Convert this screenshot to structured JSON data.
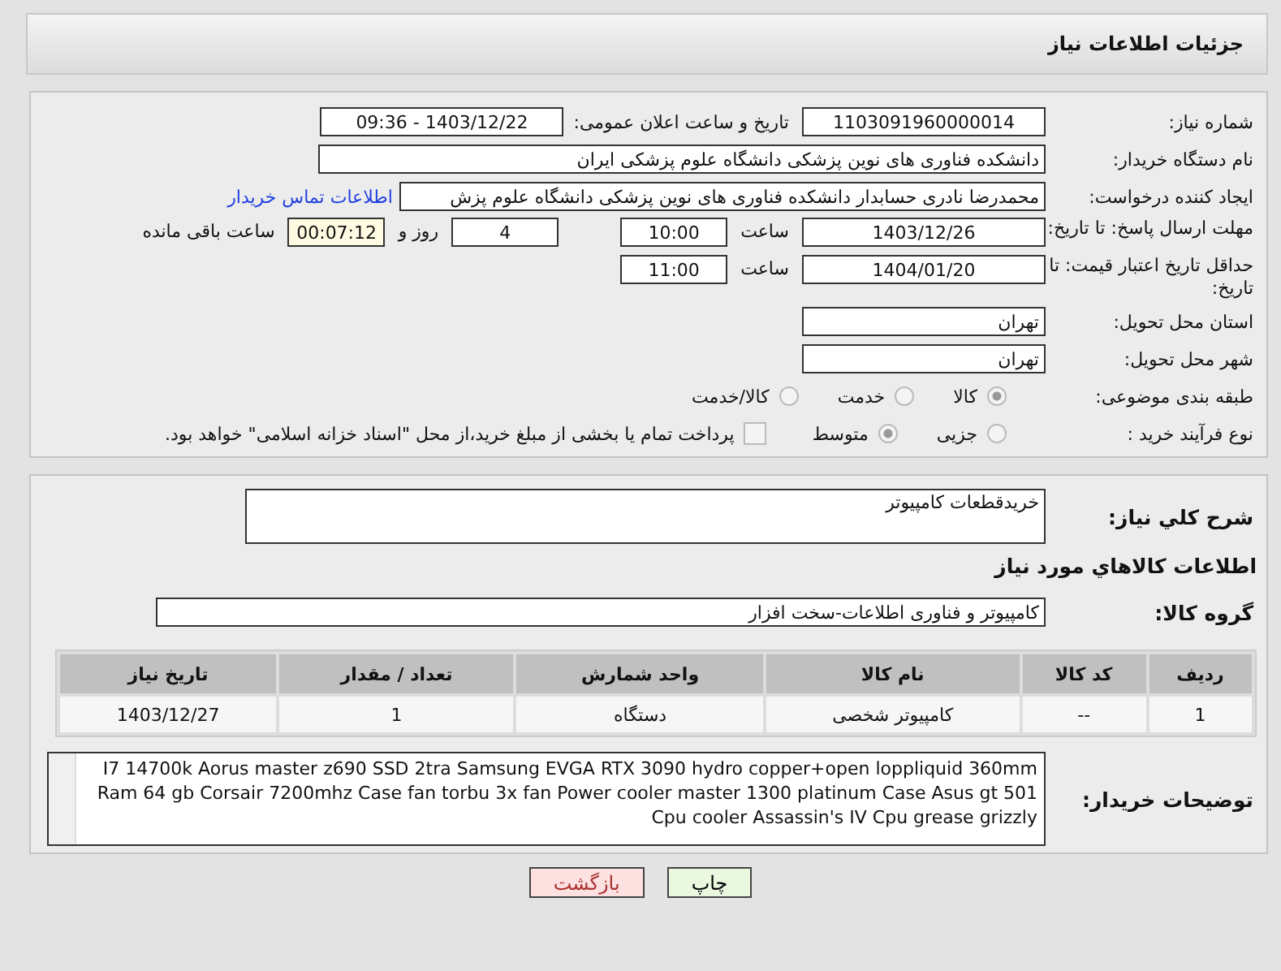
{
  "header": {
    "title": "جزئیات اطلاعات نیاز"
  },
  "need_number": {
    "label": "شماره نیاز:",
    "value": "1103091960000014"
  },
  "announce": {
    "label": "تاریخ و ساعت اعلان عمومی:",
    "value": "1403/12/22 - 09:36"
  },
  "buyer": {
    "label": "نام دستگاه خریدار:",
    "value": "دانشکده فناوری های نوین پزشکی دانشگاه علوم پزشکی ایران"
  },
  "creator": {
    "label": "ایجاد کننده درخواست:",
    "value": "محمدرضا نادری حسابدار دانشکده فناوری های نوین پزشکی دانشگاه علوم پزش",
    "link": "اطلاعات تماس خریدار"
  },
  "deadline": {
    "label": "مهلت ارسال پاسخ: تا تاریخ:",
    "date": "1403/12/26",
    "time_label": "ساعت",
    "time": "10:00",
    "days": "4",
    "days_label": "روز و",
    "remaining": "00:07:12",
    "remaining_label": "ساعت باقی مانده"
  },
  "validity": {
    "label": "حداقل تاریخ اعتبار قیمت: تا تاریخ:",
    "date": "1404/01/20",
    "time_label": "ساعت",
    "time": "11:00"
  },
  "province": {
    "label": "استان محل تحویل:",
    "value": "تهران"
  },
  "city": {
    "label": "شهر محل تحویل:",
    "value": "تهران"
  },
  "category": {
    "label": "طبقه بندی موضوعی:",
    "options": [
      {
        "label": "کالا",
        "selected": true
      },
      {
        "label": "خدمت",
        "selected": false
      },
      {
        "label": "کالا/خدمت",
        "selected": false
      }
    ]
  },
  "process": {
    "label": "نوع فرآیند خرید :",
    "options": [
      {
        "label": "جزیی",
        "selected": false
      },
      {
        "label": "متوسط",
        "selected": true
      }
    ],
    "treasury": {
      "label": "پرداخت تمام یا بخشی از مبلغ خرید،از محل \"اسناد خزانه اسلامی\" خواهد بود.",
      "checked": false
    }
  },
  "summary": {
    "label": "شرح کلي نياز:",
    "value": "خریدقطعات کامپیوتر"
  },
  "goods_heading": "اطلاعات كالاهاي مورد نياز",
  "goods_group": {
    "label": "گروه کالا:",
    "value": "کامپیوتر و فناوری اطلاعات-سخت افزار"
  },
  "table": {
    "columns": [
      "ردیف",
      "کد کالا",
      "نام کالا",
      "واحد شمارش",
      "تعداد / مقدار",
      "تاریخ نیاز"
    ],
    "rows": [
      [
        "1",
        "--",
        "کامپیوتر شخصی",
        "دستگاه",
        "1",
        "1403/12/27"
      ]
    ]
  },
  "buyer_notes": {
    "label": "توضیحات خریدار:",
    "value": "I7 14700k Aorus master z690 SSD 2tra Samsung EVGA RTX 3090 hydro copper+open loppliquid 360mm Ram 64 gb Corsair 7200mhz Case fan torbu 3x fan Power cooler master 1300 platinum Case Asus gt 501 Cpu cooler Assassin's IV Cpu grease grizzly"
  },
  "buttons": [
    {
      "label": "چاپ",
      "kind": "print"
    },
    {
      "label": "بازگشت",
      "kind": "back"
    }
  ]
}
